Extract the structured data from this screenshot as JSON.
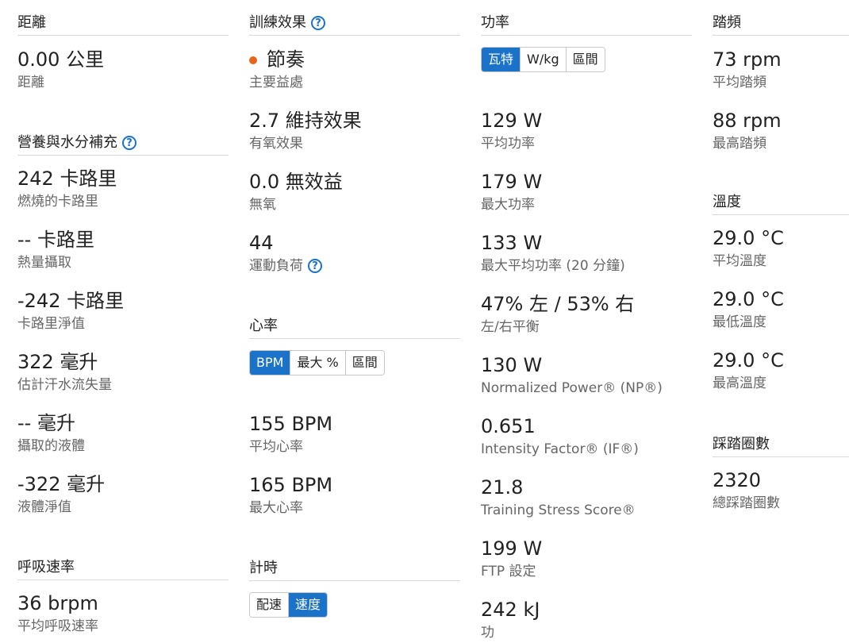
{
  "col1": {
    "distance": {
      "title": "距離",
      "value": "0.00 公里",
      "label": "距離"
    },
    "nutrition": {
      "title": "營養與水分補充",
      "stats": [
        {
          "value": "242 卡路里",
          "label": "燃燒的卡路里"
        },
        {
          "value": "-- 卡路里",
          "label": "熱量攝取"
        },
        {
          "value": "-242 卡路里",
          "label": "卡路里淨值"
        },
        {
          "value": "322 毫升",
          "label": "估計汗水流失量"
        },
        {
          "value": "-- 毫升",
          "label": "攝取的液體"
        },
        {
          "value": "-322 毫升",
          "label": "液體淨值"
        }
      ]
    },
    "respiration": {
      "title": "呼吸速率",
      "value": "36 brpm",
      "label": "平均呼吸速率"
    }
  },
  "col2": {
    "training_effect": {
      "title": "訓練效果",
      "primary": {
        "value": "節奏",
        "label": "主要益處",
        "dot_color": "#e8641b"
      },
      "aerobic": {
        "value": "2.7 維持效果",
        "label": "有氧效果"
      },
      "anaerobic": {
        "value": "0.0 無效益",
        "label": "無氧"
      },
      "load": {
        "value": "44",
        "label": "運動負荷"
      }
    },
    "heart_rate": {
      "title": "心率",
      "tabs": [
        "BPM",
        "最大 %",
        "區間"
      ],
      "active_tab": "BPM",
      "stats": [
        {
          "value": "155 BPM",
          "label": "平均心率"
        },
        {
          "value": "165 BPM",
          "label": "最大心率"
        }
      ]
    },
    "timing": {
      "title": "計時",
      "tabs": [
        "配速",
        "速度"
      ],
      "active_tab": "速度"
    }
  },
  "col3": {
    "power": {
      "title": "功率",
      "tabs": [
        "瓦特",
        "W/kg",
        "區間"
      ],
      "active_tab": "瓦特",
      "stats": [
        {
          "value": "129 W",
          "label": "平均功率"
        },
        {
          "value": "179 W",
          "label": "最大功率"
        },
        {
          "value": "133 W",
          "label": "最大平均功率 (20 分鐘)"
        },
        {
          "value": "47% 左 / 53% 右",
          "label": "左/右平衡"
        },
        {
          "value": "130 W",
          "label": "Normalized Power® (NP®)"
        },
        {
          "value": "0.651",
          "label": "Intensity Factor® (IF®)"
        },
        {
          "value": "21.8",
          "label": "Training Stress Score®"
        },
        {
          "value": "199 W",
          "label": "FTP 設定"
        },
        {
          "value": "242 kJ",
          "label": "功"
        }
      ]
    }
  },
  "col4": {
    "cadence": {
      "title": "踏頻",
      "stats": [
        {
          "value": "73 rpm",
          "label": "平均踏頻"
        },
        {
          "value": "88 rpm",
          "label": "最高踏頻"
        }
      ]
    },
    "temperature": {
      "title": "溫度",
      "stats": [
        {
          "value": "29.0 °C",
          "label": "平均溫度"
        },
        {
          "value": "29.0 °C",
          "label": "最低溫度"
        },
        {
          "value": "29.0 °C",
          "label": "最高溫度"
        }
      ]
    },
    "strokes": {
      "title": "踩踏圈數",
      "value": "2320",
      "label": "總踩踏圈數"
    }
  },
  "colors": {
    "accent": "#1a73c9",
    "primary_benefit_dot": "#e8641b"
  },
  "icons": {
    "help": "question-circle-icon"
  }
}
